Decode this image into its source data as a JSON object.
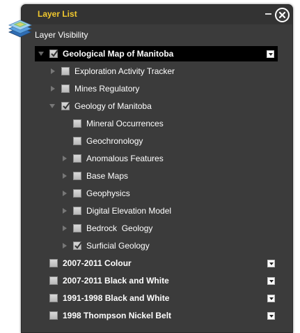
{
  "window": {
    "title": "Layer List"
  },
  "panel": {
    "subtitle": "Layer Visibility"
  },
  "colors": {
    "title": "#f2c92e",
    "panel_bg": "#3b3b3b",
    "selected_bg": "#000000"
  },
  "layers": {
    "geological_map": {
      "label": "Geological Map of Manitoba",
      "checked": true,
      "expanded": true
    },
    "exploration": {
      "label": "Exploration Activity Tracker",
      "checked": false
    },
    "mines": {
      "label": "Mines Regulatory",
      "checked": false
    },
    "geology": {
      "label": "Geology of Manitoba",
      "checked": true,
      "expanded": true
    },
    "mineral": {
      "label": "Mineral Occurrences",
      "checked": false
    },
    "geochronology": {
      "label": "Geochronology",
      "checked": false
    },
    "anomalous": {
      "label": "Anomalous Features",
      "checked": false
    },
    "base_maps": {
      "label": "Base Maps",
      "checked": false
    },
    "geophysics": {
      "label": "Geophysics",
      "checked": false
    },
    "dem": {
      "label": "Digital Elevation Model",
      "checked": false
    },
    "bedrock": {
      "label": "Bedrock  Geology",
      "checked": false
    },
    "surficial": {
      "label": "Surficial Geology",
      "checked": true
    },
    "colour_2007": {
      "label": "2007-2011 Colour",
      "checked": false
    },
    "bw_2007": {
      "label": "2007-2011 Black and White",
      "checked": false
    },
    "bw_1991": {
      "label": "1991-1998 Black and White",
      "checked": false
    },
    "thompson_1998": {
      "label": "1998 Thompson Nickel Belt",
      "checked": false
    }
  },
  "icons": {
    "panel": "layers-stack-icon",
    "minimize": "minimize-icon",
    "close": "close-icon"
  }
}
